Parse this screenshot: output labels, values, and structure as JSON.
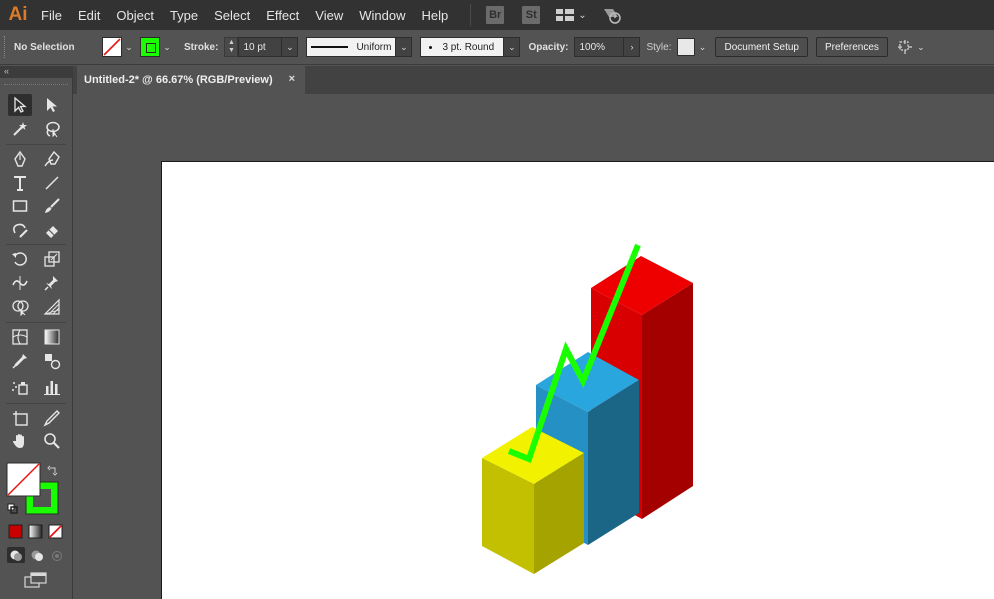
{
  "app": {
    "logo": "Ai"
  },
  "menu": [
    "File",
    "Edit",
    "Object",
    "Type",
    "Select",
    "Effect",
    "View",
    "Window",
    "Help"
  ],
  "bridge_badge": "Br",
  "stock_badge": "St",
  "control": {
    "selection": "No Selection",
    "stroke_label": "Stroke:",
    "stroke_weight": "10 pt",
    "profile": "Uniform",
    "brush": "3 pt. Round",
    "opacity_label": "Opacity:",
    "opacity": "100%",
    "style_label": "Style:",
    "document_setup": "Document Setup",
    "preferences": "Preferences"
  },
  "tab": {
    "title": "Untitled-2* @ 66.67% (RGB/Preview)",
    "close": "×"
  },
  "colors": {
    "fill": "#ffffff",
    "stroke": "#1aff00",
    "yellow_top": "#f2f200",
    "yellow_left": "#c2c000",
    "yellow_right": "#a5a300",
    "blue_top": "#2aa6de",
    "blue_left": "#2590c3",
    "blue_right": "#1b6586",
    "red_top": "#ee0000",
    "red_left": "#d80000",
    "red_right": "#a50000",
    "arrow": "#1aff00"
  }
}
